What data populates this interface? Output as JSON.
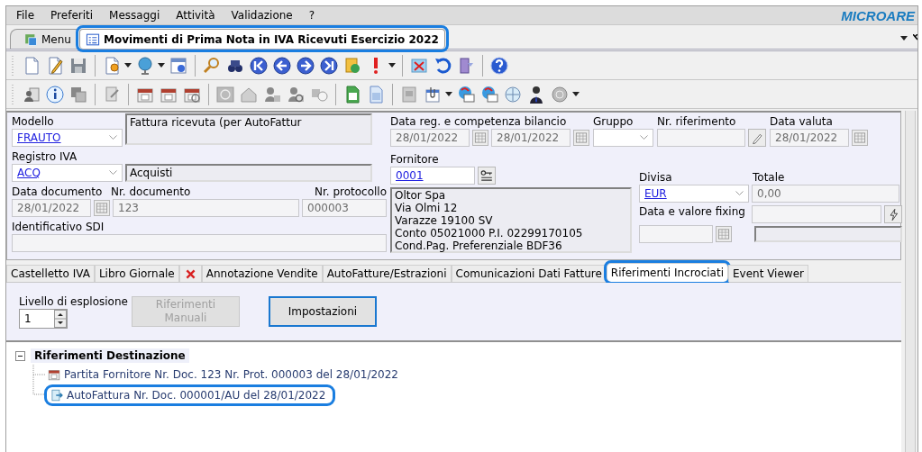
{
  "menu_bar": {
    "items": [
      "File",
      "Preferiti",
      "Messaggi",
      "Attività",
      "Validazione",
      "?"
    ],
    "logo": "MICROARE"
  },
  "document_tabs": [
    {
      "label": "Menu",
      "selected": false,
      "highlighted": false
    },
    {
      "label": "Movimenti di Prima Nota in IVA Ricevuti Esercizio 2022",
      "selected": true,
      "highlighted": true
    }
  ],
  "form": {
    "modello": {
      "label": "Modello",
      "value": "FRAUTO",
      "description": "Fattura ricevuta (per AutoFattur"
    },
    "registro_iva": {
      "label": "Registro IVA",
      "value": "ACQ",
      "description": "Acquisti"
    },
    "data_documento": {
      "label": "Data documento",
      "value": "28/01/2022"
    },
    "nr_documento": {
      "label": "Nr. documento",
      "value": "123"
    },
    "nr_protocollo": {
      "label": "Nr. protocollo",
      "value": "000003"
    },
    "identificativo_sdi": {
      "label": "Identificativo SDI"
    },
    "data_reg": {
      "label": "Data reg. e competenza bilancio",
      "value": "28/01/2022",
      "value_2": "28/01/2022"
    },
    "gruppo": {
      "label": "Gruppo"
    },
    "nr_riferimento": {
      "label": "Nr. riferimento"
    },
    "data_valuta": {
      "label": "Data valuta",
      "value": "28/01/2022"
    },
    "fornitore": {
      "label": "Fornitore",
      "value": "0001",
      "address_lines": [
        "Oltor Spa",
        "Via Olmi 12",
        "Varazze 19100 SV",
        "Conto 05021000 P.I. 02299170105",
        "Cond.Pag. Preferenziale BDF36"
      ]
    },
    "divisa": {
      "label": "Divisa",
      "value": "EUR"
    },
    "totale": {
      "label": "Totale",
      "value": "0,00"
    },
    "fixing": {
      "label": "Data e valore fixing"
    }
  },
  "detail_tabs": [
    {
      "kind": "text",
      "label": "Castelletto IVA",
      "selected": false,
      "highlighted": false
    },
    {
      "kind": "text",
      "label": "Libro Giornale",
      "selected": false,
      "highlighted": false
    },
    {
      "kind": "icon",
      "selected": false,
      "highlighted": false
    },
    {
      "kind": "text",
      "label": "Annotazione Vendite",
      "selected": false,
      "highlighted": false
    },
    {
      "kind": "text",
      "label": "AutoFatture/Estrazioni",
      "selected": false,
      "highlighted": false
    },
    {
      "kind": "text",
      "label": "Comunicazioni Dati Fatture",
      "selected": false,
      "highlighted": false
    },
    {
      "kind": "text",
      "label": "Riferimenti Incrociati",
      "selected": true,
      "highlighted": true
    },
    {
      "kind": "text",
      "label": "Event Viewer",
      "selected": false,
      "highlighted": false
    }
  ],
  "explosion_level": {
    "label": "Livello di esplosione",
    "value": "1"
  },
  "buttons": [
    {
      "label": "Riferimenti Manuali",
      "disabled": true,
      "focused": false
    },
    {
      "label": "Impostazioni",
      "disabled": false,
      "focused": true
    }
  ],
  "tree": {
    "label": "Riferimenti Destinazione",
    "expanded": true,
    "children": [
      {
        "kind": "calendar",
        "label": "Partita Fornitore Nr. Doc. 123 Nr. Prot. 000003 del 28/01/2022",
        "highlighted": false
      },
      {
        "kind": "invoice",
        "label": "AutoFattura Nr. Doc. 000001/AU del 28/01/2022",
        "highlighted": true
      }
    ]
  }
}
